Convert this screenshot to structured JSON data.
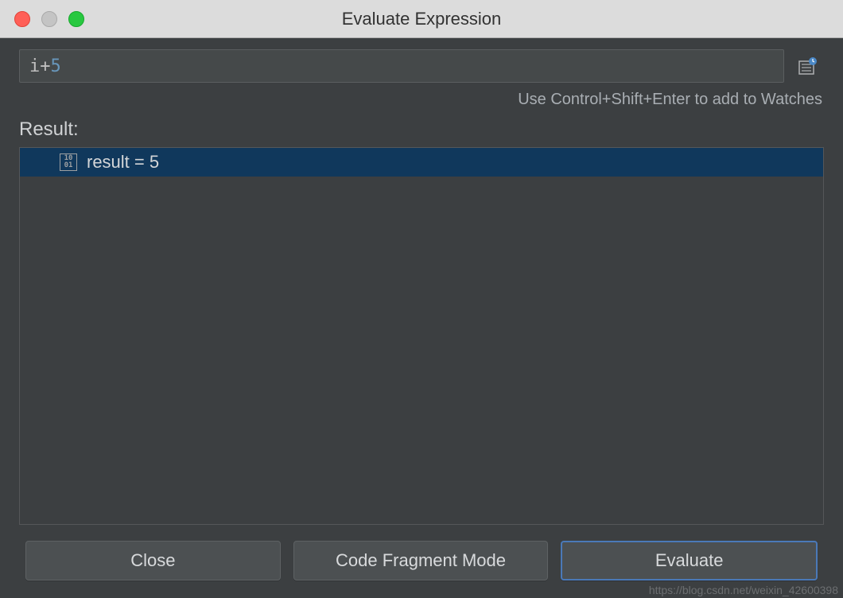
{
  "window": {
    "title": "Evaluate Expression"
  },
  "expression": {
    "var": "i",
    "op": " + ",
    "num": "5",
    "hint": "Use Control+Shift+Enter to add to Watches"
  },
  "result": {
    "label": "Result:",
    "icon_text": "10\n01",
    "text": "result = 5"
  },
  "buttons": {
    "close": "Close",
    "fragment": "Code Fragment Mode",
    "evaluate": "Evaluate"
  },
  "watermark": "https://blog.csdn.net/weixin_42600398"
}
